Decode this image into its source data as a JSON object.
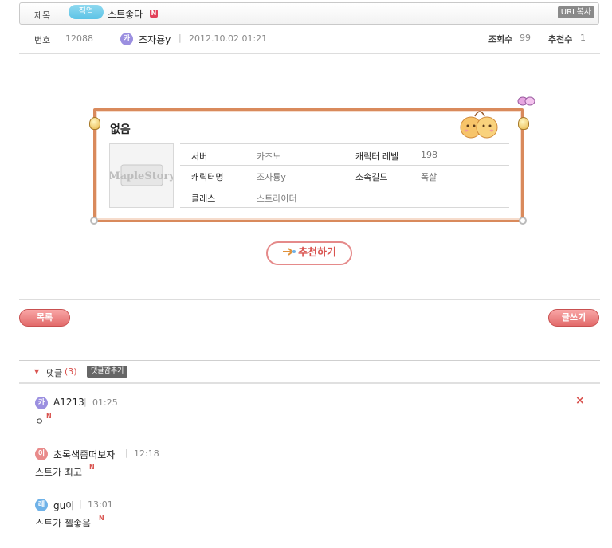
{
  "header": {
    "subject_label": "제목",
    "category_tag": "직업",
    "post_title": "스트좋다",
    "new_badge": "N",
    "url_copy": "URL복사"
  },
  "meta": {
    "number_label": "번호",
    "number": "12088",
    "author_avatar": "카",
    "author": "조자룡y",
    "datetime": "2012.10.02 01:21",
    "views_label": "조회수",
    "views": "99",
    "recommend_label": "추천수",
    "recommend": "1"
  },
  "character_card": {
    "status": "없음",
    "image_alt": "MapleStory",
    "fields": {
      "server_label": "서버",
      "server": "카즈노",
      "level_label": "캐릭터 레벨",
      "level": "198",
      "name_label": "캐릭터명",
      "name": "조자룡y",
      "guild_label": "소속길드",
      "guild": "폭살",
      "class_label": "클래스",
      "class": "스트라이더"
    }
  },
  "actions": {
    "recommend_button": "추천하기",
    "list_button": "목록",
    "write_button": "글쓰기"
  },
  "comments": {
    "header_label": "댓글",
    "count": "(3)",
    "hide_button": "댓글감추기",
    "delete_icon": "×",
    "items": [
      {
        "avatar": "카",
        "avatar_color": "#9b8fe0",
        "name": "A1213",
        "time": "01:25",
        "text": "ㅇ",
        "badge": "N"
      },
      {
        "avatar": "이",
        "avatar_color": "#e98b8b",
        "name": "초록색좀떠보자",
        "time": "12:18",
        "text": "스트가 최고",
        "badge": "N"
      },
      {
        "avatar": "레",
        "avatar_color": "#6fb2e8",
        "name": "gu이",
        "time": "13:01",
        "text": "스트가 젤좋음",
        "badge": "N"
      }
    ]
  },
  "colors": {
    "accent_red": "#d9534f",
    "tag_blue": "#5cc3e6",
    "card_border": "#d98a5c"
  }
}
